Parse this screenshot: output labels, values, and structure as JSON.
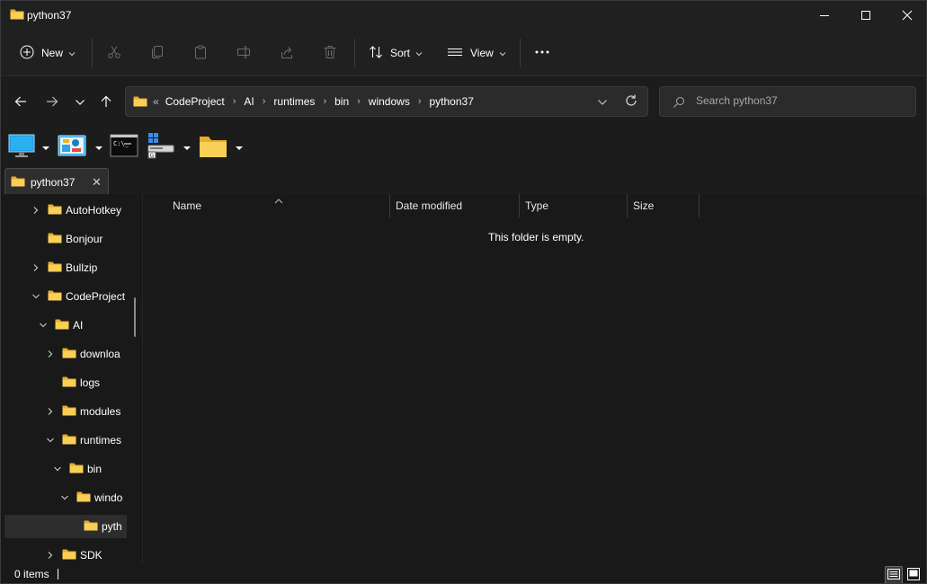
{
  "window": {
    "title": "python37"
  },
  "commandbar": {
    "new_label": "New",
    "sort_label": "Sort",
    "view_label": "View"
  },
  "address": {
    "overflow_label": "«",
    "crumbs": [
      "CodeProject",
      "AI",
      "runtimes",
      "bin",
      "windows",
      "python37"
    ]
  },
  "search": {
    "placeholder": "Search python37"
  },
  "tabs": [
    {
      "label": "python37"
    }
  ],
  "nav_tree": [
    {
      "label": "AutoHotkey",
      "expander": "collapsed"
    },
    {
      "label": "Bonjour",
      "expander": "none"
    },
    {
      "label": "Bullzip",
      "expander": "collapsed"
    },
    {
      "label": "CodeProject",
      "expander": "expanded"
    },
    {
      "label": "AI",
      "expander": "expanded"
    },
    {
      "label": "downloa",
      "expander": "collapsed"
    },
    {
      "label": "logs",
      "expander": "none"
    },
    {
      "label": "modules",
      "expander": "collapsed"
    },
    {
      "label": "runtimes",
      "expander": "expanded"
    },
    {
      "label": "bin",
      "expander": "expanded"
    },
    {
      "label": "windo",
      "expander": "expanded"
    },
    {
      "label": "pyth",
      "expander": "none",
      "selected": true
    },
    {
      "label": "SDK",
      "expander": "collapsed"
    }
  ],
  "columns": [
    "Name",
    "Date modified",
    "Type",
    "Size"
  ],
  "content": {
    "empty_message": "This folder is empty."
  },
  "status": {
    "items_text": "0 items"
  },
  "icons": {
    "folder": "folder-icon",
    "new": "plus-circle-icon",
    "cut": "scissors-icon",
    "copy": "copy-icon",
    "paste": "clipboard-icon",
    "rename": "rename-icon",
    "share": "share-icon",
    "delete": "trash-icon",
    "sort": "sort-arrows-icon",
    "view": "view-lines-icon",
    "more": "ellipsis-icon"
  },
  "colors": {
    "background": "#191919",
    "chrome": "#202020",
    "folder_yellow": "#f5c242",
    "text": "#ffffff"
  }
}
